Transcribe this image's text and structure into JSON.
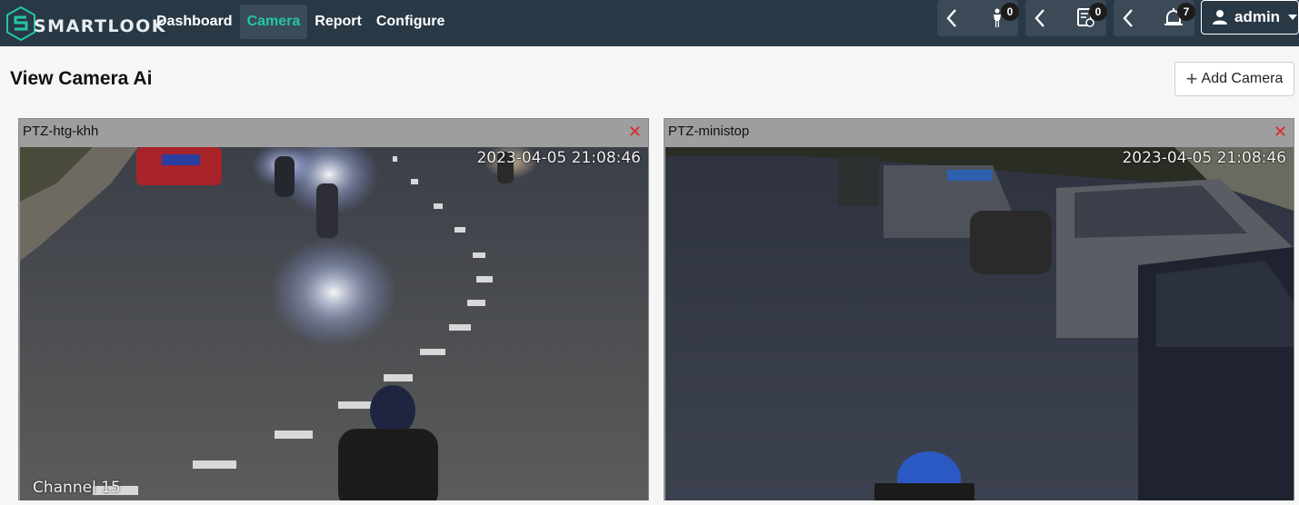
{
  "brand": {
    "name": "SMARTLOOK",
    "accent": "#23c6a6"
  },
  "nav": {
    "links": [
      "Dashboard",
      "Camera",
      "Report",
      "Configure"
    ],
    "active": "Camera"
  },
  "notifications": [
    {
      "icon": "person-alert-icon",
      "count": "0"
    },
    {
      "icon": "document-alert-icon",
      "count": "0"
    },
    {
      "icon": "bell-alert-icon",
      "count": "7"
    }
  ],
  "user": {
    "name": "admin"
  },
  "page": {
    "title": "View Camera Ai",
    "add_button": "Add Camera"
  },
  "cameras": [
    {
      "name": "PTZ-htg-khh",
      "timestamp": "2023-04-05 21:08:46",
      "channel": "Channel 15"
    },
    {
      "name": "PTZ-ministop",
      "timestamp": "2023-04-05 21:08:46",
      "channel": ""
    }
  ]
}
